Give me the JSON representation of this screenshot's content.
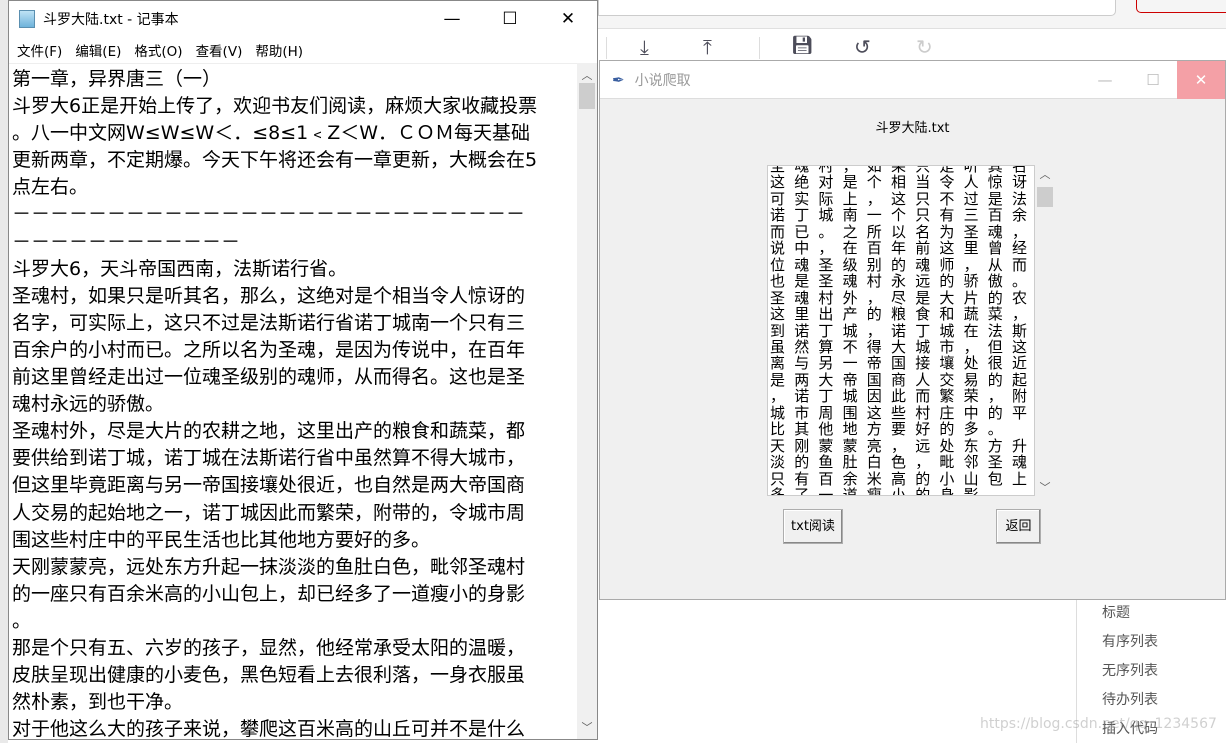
{
  "background_app": {
    "toolbar_icons": [
      "download-icon",
      "upload-icon",
      "save-icon",
      "undo-icon",
      "redo-icon"
    ],
    "side_menu": [
      "标题",
      "有序列表",
      "无序列表",
      "待办列表",
      "插入代码"
    ],
    "watermark": "https://blog.csdn.net/qq_1234567"
  },
  "notepad": {
    "title": "斗罗大陆.txt - 记事本",
    "menu": [
      "文件(F)",
      "编辑(E)",
      "格式(O)",
      "查看(V)",
      "帮助(H)"
    ],
    "lines": [
      "第一章，异界唐三（一）",
      "斗罗大6正是开始上传了，欢迎书友们阅读，麻烦大家收藏投票",
      "。八一中文网W≤W≤W＜．≤8≤1﹤Z＜W．ＣＯＭ每天基础",
      "更新两章，不定期爆。今天下午将还会有一章更新，大概会在5",
      "点左右。",
      "－－－－－－－－－－－－－－－－－－－－－－－－－－－",
      "－－－－－－－－－－－－",
      "斗罗大6，天斗帝国西南，法斯诺行省。",
      "圣魂村，如果只是听其名，那么，这绝对是个相当令人惊讶的",
      "名字，可实际上，这只不过是法斯诺行省诺丁城南一个只有三",
      "百余户的小村而已。之所以名为圣魂，是因为传说中，在百年",
      "前这里曾经走出过一位魂圣级别的魂师，从而得名。这也是圣",
      "魂村永远的骄傲。",
      "圣魂村外，尽是大片的农耕之地，这里出产的粮食和蔬菜，都",
      "要供给到诺丁城，诺丁城在法斯诺行省中虽然算不得大城市，",
      "但这里毕竟距离与另一帝国接壤处很近，也自然是两大帝国商",
      "人交易的起始地之一，诺丁城因此而繁荣，附带的，令城市周",
      "围这些村庄中的平民生活也比其他地方要好的多。",
      "天刚蒙蒙亮，远处东方升起一抹淡淡的鱼肚白色，毗邻圣魂村",
      "的一座只有百余米高的小山包上，却已经多了一道瘦小的身影",
      "。",
      "那是个只有五、六岁的孩子，显然，他经常承受太阳的温暖，",
      "皮肤呈现出健康的小麦色，黑色短看上去很利落，一身衣服虽",
      "然朴素，到也干净。",
      "对于他这么大的孩子来说，攀爬这百米高的山丘可并不是什么"
    ]
  },
  "tk_window": {
    "title": "小说爬取",
    "label": "斗罗大陆.txt",
    "text_lines": [
      "圣魂村，如果只是听其名，那么，",
      "这绝对是个相当令人惊讶的名字，",
      "可实际上，这只不过是法斯诺行省",
      "诺丁城南一个只有三百余户的小村",
      "而已。之所以名为圣魂，是因为传",
      "说中，在百年前这里曾经走出过一",
      "位魂圣级别的魂师，从而得名。这",
      "也是圣魂村永远的骄傲。",
      "圣魂村外，尽是大片的农耕之地，",
      "这里出产的粮食和蔬菜，都要供给",
      "到诺丁城，诺丁城在法斯诺行省中",
      "虽然算不得大城市，但这里毕竟距",
      "离与另一帝国接壤处很近，也自然",
      "是两大帝国商人交易的起始地之一",
      "，诺丁城因此而繁荣，附带的，令",
      "城市周围这些村庄中的平民生活也",
      "比其他地方要好的多。",
      "天刚蒙蒙亮，远处东方升起一抹淡",
      "淡的鱼肚白色，毗邻圣魂村的一座",
      "只有百余米高的小山包上，却已经",
      "多了一道瘦小的身影"
    ],
    "read_button": "txt阅读",
    "back_button": "返回"
  }
}
